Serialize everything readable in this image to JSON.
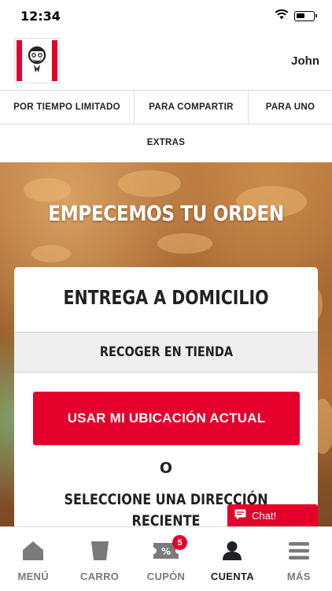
{
  "status_bar": {
    "time": "12:34"
  },
  "header": {
    "user_name": "John"
  },
  "category_nav": {
    "tabs": [
      {
        "label": "POR TIEMPO LIMITADO"
      },
      {
        "label": "PARA COMPARTIR"
      },
      {
        "label": "PARA UNO"
      },
      {
        "label": "EXTRAS"
      }
    ]
  },
  "hero": {
    "title": "EMPECEMOS TU ORDEN"
  },
  "order_card": {
    "delivery_title": "ENTREGA A DOMICILIO",
    "pickup_label": "RECOGER EN TIENDA",
    "location_button": "USAR MI UBICACIÓN ACTUAL",
    "or_text": "O",
    "recent_title": "SELECCIONE UNA DIRECCIÓN RECIENTE"
  },
  "chat": {
    "label": "Chat!"
  },
  "bottom_nav": {
    "items": [
      {
        "label": "MENÚ",
        "icon": "home-icon"
      },
      {
        "label": "CARRO",
        "icon": "bucket-icon"
      },
      {
        "label": "CUPÓN",
        "icon": "coupon-icon",
        "badge": "5"
      },
      {
        "label": "CUENTA",
        "icon": "user-icon",
        "active": true
      },
      {
        "label": "MÁS",
        "icon": "menu-icon"
      }
    ]
  },
  "colors": {
    "brand_red": "#e4002b",
    "text_dark": "#202124",
    "nav_inactive": "#7a7a7a"
  },
  "status": {
    "battery_level": 0.45
  }
}
